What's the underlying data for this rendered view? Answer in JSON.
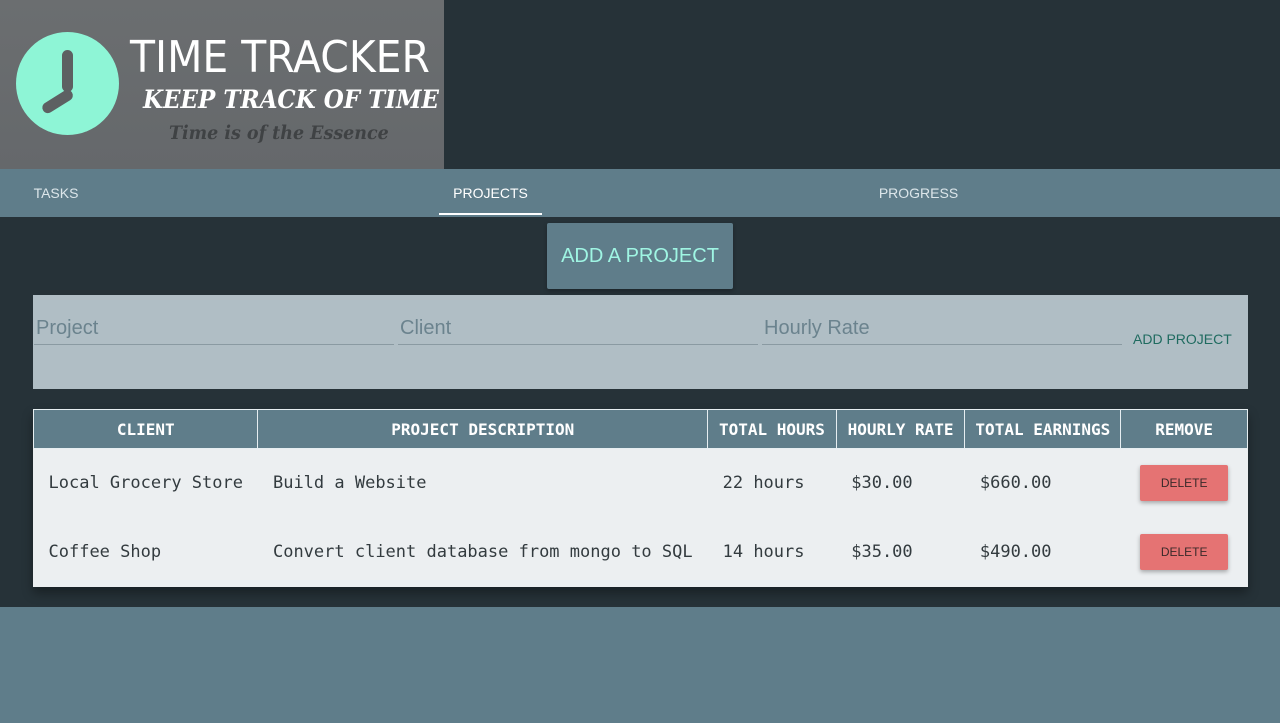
{
  "logo": {
    "title": "TIME TRACKER",
    "subtitle": "KEEP TRACK OF TIME",
    "tagline": "Time is of the Essence",
    "icon": "clock-icon"
  },
  "nav": {
    "tabs": [
      {
        "label": "TASKS",
        "active": false
      },
      {
        "label": "PROJECTS",
        "active": true
      },
      {
        "label": "PROGRESS",
        "active": false
      }
    ]
  },
  "add_project_header": "ADD A PROJECT",
  "form": {
    "project_placeholder": "Project",
    "client_placeholder": "Client",
    "rate_placeholder": "Hourly Rate",
    "submit_label": "ADD PROJECT"
  },
  "table": {
    "headers": [
      "CLIENT",
      "PROJECT DESCRIPTION",
      "TOTAL HOURS",
      "HOURLY RATE",
      "TOTAL EARNINGS",
      "REMOVE"
    ],
    "rows": [
      {
        "client": "Local Grocery Store",
        "description": "Build a Website",
        "hours": "22 hours",
        "rate": "$30.00",
        "earnings": "$660.00",
        "action": "DELETE"
      },
      {
        "client": "Coffee Shop",
        "description": "Convert client database from mongo to SQL",
        "hours": "14 hours",
        "rate": "$35.00",
        "earnings": "$490.00",
        "action": "DELETE"
      }
    ]
  },
  "colors": {
    "background": "#263238",
    "nav": "#5f7d8a",
    "accent": "#8ef5d6",
    "form_panel": "#b0bec5",
    "delete": "#e57373"
  }
}
